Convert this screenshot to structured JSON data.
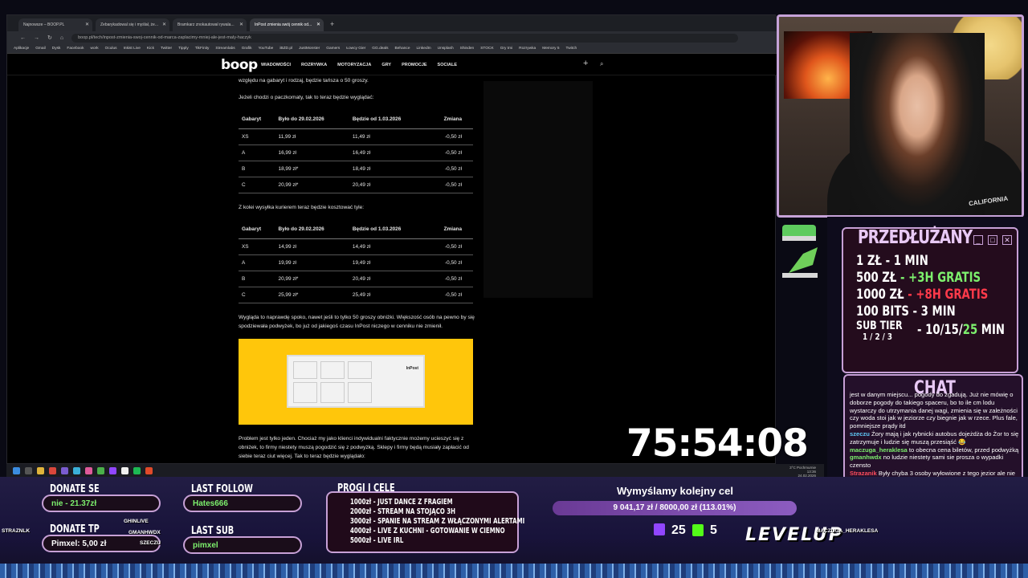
{
  "browser": {
    "tabs": [
      {
        "title": "Najnowsze – BOOP.PL"
      },
      {
        "title": "Zebarykadowal się i myślał, że..."
      },
      {
        "title": "Bramkarz znokautował rywala..."
      },
      {
        "title": "InPost zmienia swój cennik od..."
      }
    ],
    "new_tab": "+",
    "url": "boop.pl/tech/inpost-zmienia-swoj-cennik-od-marca-zaplacimy-mniej-ale-jest-maly-haczyk",
    "bookmarks": [
      "Aplikacje",
      "Gmail",
      "Dysk",
      "Facebook",
      "work",
      "Oculus",
      "Inkist Live",
      "Kick",
      "Twitter",
      "Tipply",
      "TikFinity",
      "Streamlabs",
      "Grafik",
      "YouTube",
      "iBZD.pl",
      "JustMonster",
      "Gamers",
      "Łowcy Gier",
      "GG.deals",
      "Behance",
      "LinkedIn",
      "Unsplash",
      "Shinden",
      "STOCK",
      "Gry tmi",
      "Rozrywka",
      "Memory 5",
      "Twitch"
    ]
  },
  "site": {
    "logo": "boop",
    "nav": [
      "WIADOMOŚCI",
      "ROZRYWKA",
      "MOTORYZACJA",
      "GRY",
      "PROMOCJE",
      "SOCIALE"
    ],
    "plus": "+",
    "search_icon": "⌕"
  },
  "article": {
    "intro": "względu na gabaryt i rodzaj, będzie tańsza o 50 groszy.",
    "p_paczkomaty": "Jeżeli chodzi o paczkomaty, tak to teraz będzie wyglądać:",
    "table_headers": [
      "Gabaryt",
      "Było do 29.02.2026",
      "Będzie od 1.03.2026",
      "Zmiana"
    ],
    "table1": [
      [
        "XS",
        "11,99 zł",
        "11,49 zł",
        "-0,50 zł"
      ],
      [
        "A",
        "16,99 zł",
        "16,49 zł",
        "-0,50 zł"
      ],
      [
        "B",
        "18,99 zł*",
        "18,49 zł",
        "-0,50 zł"
      ],
      [
        "C",
        "20,99 zł*",
        "20,49 zł",
        "-0,50 zł"
      ]
    ],
    "p_kurier": "Z kolei wysyłka kurierem teraz będzie kosztować tyle:",
    "table2": [
      [
        "XS",
        "14,99 zł",
        "14,49 zł",
        "-0,50 zł"
      ],
      [
        "A",
        "19,99 zł",
        "19,49 zł",
        "-0,50 zł"
      ],
      [
        "B",
        "20,99 zł*",
        "20,49 zł",
        "-0,50 zł"
      ],
      [
        "C",
        "25,99 zł*",
        "25,49 zł",
        "-0,50 zł"
      ]
    ],
    "p_spoko": "Wygląda to naprawdę spoko, nawet jeśli to tylko 50 groszy obniżki. Większość osób na pewno by się spodziewała podwyżek, bo już od jakiegoś czasu InPost niczego w cenniku nie zmienił.",
    "image_brand": "InPost",
    "p_problem": "Problem jest tylko jeden. Chociaż my jako klienci indywidualni faktycznie możemy ucieszyć się z obniżek, to firmy niestety muszą pogodzić się z podwyżką. Sklepy i firmy będą musiały zapłacić od siebie teraz ciut więcej. Tak to teraz będzie wyglądało:"
  },
  "timer": "75:54:08",
  "tray": {
    "weather": "3°C Pochmurnie",
    "time": "13:36",
    "date": "24.02.2026"
  },
  "przedluzany": {
    "title": "PRZEDŁUŻANY",
    "rows": [
      {
        "left": "1 ZŁ",
        "right": "- 1 MIN",
        "accent": ""
      },
      {
        "left": "500 ZŁ",
        "right": "- +3H GRATIS",
        "accent": "green"
      },
      {
        "left": "1000 ZŁ",
        "right": "- +8H GRATIS",
        "accent": "red"
      },
      {
        "left": "100 BITS",
        "right": "- 3 MIN",
        "accent": ""
      }
    ],
    "sub_tier": "SUB TIER",
    "sub_tier_levels": "1 / 2 / 3",
    "sub_values": "- 10/15/",
    "sub_values_accent": "25",
    "sub_values_suffix": " MIN"
  },
  "chat": {
    "title": "CHAT",
    "messages": [
      {
        "user": "",
        "text": "jest w danym miejscu... pogody do zgadują. Już nie mówię o doborze pogody do takiego spaceru, bo to ile cm lodu wystarczy do utrzymania danej wagi, zmienia się w zależności czy woda stoi jak w jeziorze czy biegnie jak w rzece. Plus fale, pomniejsze prądy itd",
        "color": "#ffffff"
      },
      {
        "user": "szeczu",
        "text": "Żory mają i jak rybnicki autobus dojeżdża do Żor to się zatrzymuje i ludzie się muszą przesiąść 😂",
        "color": "#5fc9f8"
      },
      {
        "user": "maczuga_heraklesa",
        "text": "to obecna cena biletów, przed podwyżką",
        "color": "#7df06d"
      },
      {
        "user": "gmanhwdx",
        "text": "no ludzie niestety sami sie prosza o wypadki czensto",
        "color": "#7df06d"
      },
      {
        "user": "Strazanik",
        "text": "Były chyba 3 osoby wyłowione z tego jezior ale nie wiadomo czy to były wypadki w związku z załamaniem lodu czy inne sprawy",
        "color": "#ff4d5e"
      }
    ]
  },
  "bottom": {
    "donate_se_label": "DONATE SE",
    "donate_se_value": "nie - 21.37zł",
    "donate_tp_label": "DONATE TP",
    "donate_tp_value": "Pimxel: 5,00 zł",
    "last_follow_label": "LAST FOLLOW",
    "last_follow_value": "Hates666",
    "last_sub_label": "LAST SUB",
    "last_sub_value": "pimxel",
    "progi_title": "PROGI I CELE",
    "progi": [
      "1000zł - JUST DANCE Z FRAGIEM",
      "2000zł - STREAM NA STOJĄCO 3H",
      "3000zł - SPANIE NA STREAM Z WŁĄCZONYMI ALERTAMI",
      "4000zł - LIVE Z KUCHNI - GOTOWANIE W CIEMNO",
      "5000zł - LIVE IRL"
    ],
    "goal_title": "Wymyślamy kolejny cel",
    "goal_text": "9 041,17 zł / 8000,00 zł (113.01%)",
    "goal_progress": 1.0,
    "twitch_viewers": "25",
    "kick_viewers": "5",
    "levelup": "LEVELUP",
    "player_tags": [
      "STRAZNLK",
      "GHINLIVE",
      "GMANHWDX",
      "SZECZU",
      "MACZUGA_HERAKLESA"
    ],
    "colors": {
      "accent_border": "#c7a0d6",
      "green": "#7df06d",
      "red": "#ff3a4a"
    }
  }
}
